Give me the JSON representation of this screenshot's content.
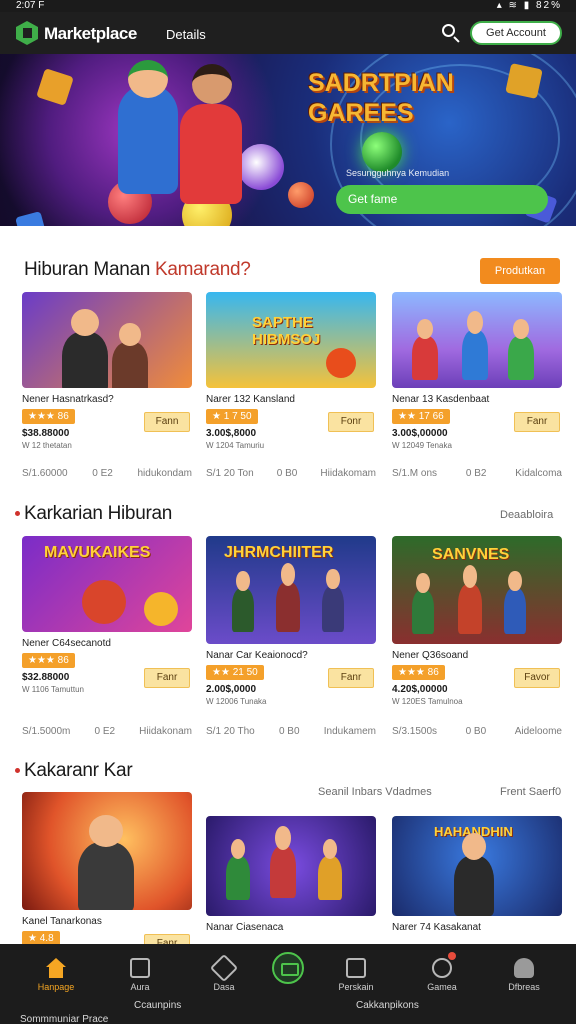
{
  "status_bar": {
    "time": "2:07 F",
    "icons": "▴ ≋ ▮ 82%"
  },
  "header": {
    "brand": "Marketplace",
    "tab": "Details",
    "account_button": "Get Account",
    "icons": [
      "logo-icon",
      "search-icon"
    ]
  },
  "hero": {
    "title": "SADRTPIAN GAREES",
    "tagline": "Sesungguhnya Kemudian",
    "cta": "Get fame",
    "colors": {
      "bg": "#1b1348",
      "accent": "#4dc44b",
      "title": "#f7b733"
    }
  },
  "section1": {
    "title": "Hiburan Manan",
    "title_accent": "Kamarand?",
    "action": "Produtkan",
    "cards": [
      {
        "name": "Nener Hasnatrkasd?",
        "rating": "★★★ 86",
        "price": "$38.88000",
        "meta": "W 12 thetatan",
        "buy": "Fann",
        "foot_left": "S/1.60000",
        "foot_mid": "0 E2",
        "foot_right": "hidukondam"
      },
      {
        "name": "Narer 132 Kansland",
        "rating": "★ 1 7 50",
        "price": "3.00$,8000",
        "meta": "W 1204 Tamuriu",
        "buy": "Fonr",
        "foot_left": "S/1 20 Ton",
        "foot_mid": "0 B0",
        "foot_right": "Hiidakomam"
      },
      {
        "name": "Nenar 13 Kasdenbaat",
        "rating": "★★ 17 66",
        "price": "3.00$,00000",
        "meta": "W 12049 Tenaka",
        "buy": "Fanr",
        "foot_left": "S/1.M ons",
        "foot_mid": "0 B2",
        "foot_right": "Kidalcoma"
      }
    ]
  },
  "section2": {
    "title": "Karkarian Hiburan",
    "action": "Deaabloira",
    "cards": [
      {
        "name": "Nener C64secanotd",
        "rating": "★★★ 86",
        "price": "$32.88000",
        "meta": "W 1106 Tamuttun",
        "buy": "Fanr",
        "foot_left": "S/1.5000m",
        "foot_mid": "0 E2",
        "foot_right": "Hiidakonam",
        "thumb_title": "MAVUKAIKES"
      },
      {
        "name": "Nanar Car Keaionocd?",
        "rating": "★★ 21 50",
        "price": "2.00$,0000",
        "meta": "W 12006 Tunaka",
        "buy": "Fanr",
        "foot_left": "S/1 20 Tho",
        "foot_mid": "0 B0",
        "foot_right": "Indukamem",
        "thumb_title": "JHRMCHIITER"
      },
      {
        "name": "Nener Q36soand",
        "rating": "★★★ 86",
        "price": "4.20$,00000",
        "meta": "W 120ES Tamulnoa",
        "buy": "Favor",
        "foot_left": "S/3.1500s",
        "foot_mid": "0 B0",
        "foot_right": "Aideloome",
        "thumb_title": "SANVNES"
      }
    ]
  },
  "section3": {
    "title": "Kakaranr Kar",
    "link_left": "Seanil Inbars Vdadmes",
    "link_right": "Frent Saerf0",
    "cards": [
      {
        "name": "Kanel Tanarkonas",
        "rating": "★ 4.8",
        "buy": "Fanr"
      },
      {
        "name": "Nanar Ciasenaca"
      },
      {
        "name": "Narer 74 Kasakanat"
      }
    ],
    "thumb_title": "HAHANDHIN"
  },
  "bottom_nav": {
    "items": [
      {
        "label": "Hanpage",
        "icon": "home-icon"
      },
      {
        "label": "Aura",
        "icon": "gamepad-icon"
      },
      {
        "label": "Dasa",
        "icon": "tag-icon"
      },
      {
        "label": "",
        "icon": "store-icon"
      },
      {
        "label": "Perskain",
        "icon": "box-icon"
      },
      {
        "label": "Gamea",
        "icon": "heart-icon"
      },
      {
        "label": "Dfbreas",
        "icon": "profile-icon"
      }
    ],
    "bottom_text_left": "Sommmuniar Prace",
    "bottom_text_mid": "Ccaunpins",
    "bottom_text_right": "Cakkanpikons"
  }
}
